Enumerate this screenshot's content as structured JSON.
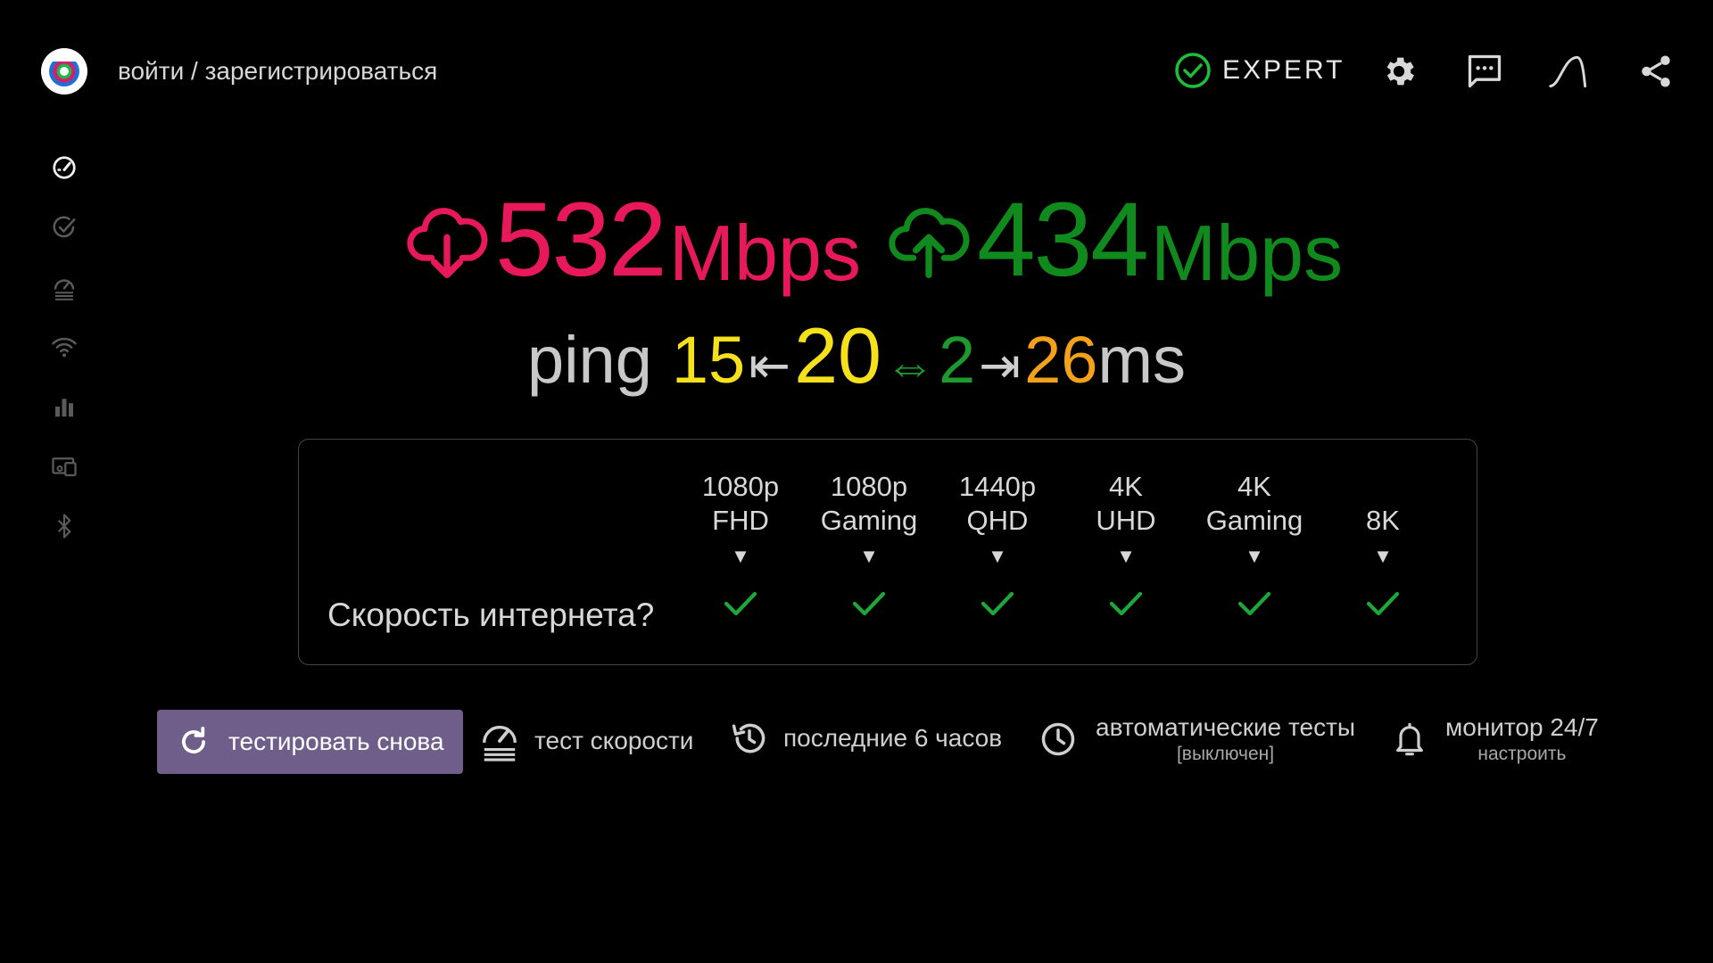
{
  "header": {
    "login_text": "войти / зарегистрироваться",
    "expert_label": "EXPERT"
  },
  "icons": {
    "logo": "app-logo",
    "top": [
      "check-circle-icon",
      "gear-icon",
      "chat-icon",
      "curve-icon",
      "share-icon"
    ],
    "sidebar": [
      "speedometer-icon",
      "check-circle-icon",
      "speedtest-history-icon",
      "wifi-icon",
      "bar-chart-icon",
      "devices-icon",
      "bluetooth-icon"
    ]
  },
  "speeds": {
    "download_value": "532",
    "download_unit": "Mbps",
    "upload_value": "434",
    "upload_unit": "Mbps"
  },
  "ping": {
    "label": "ping",
    "min": "15",
    "left_arrow": "⇤",
    "median": "20",
    "double_arrow": "⇔",
    "jitter": "2",
    "right_arrow": "⇥",
    "max": "26",
    "unit": "ms"
  },
  "quality": {
    "question": "Скорость интернета?",
    "columns": [
      {
        "line1": "1080p",
        "line2": "FHD",
        "ok": true
      },
      {
        "line1": "1080p",
        "line2": "Gaming",
        "ok": true
      },
      {
        "line1": "1440p",
        "line2": "QHD",
        "ok": true
      },
      {
        "line1": "4K",
        "line2": "UHD",
        "ok": true
      },
      {
        "line1": "4K",
        "line2": "Gaming",
        "ok": true
      },
      {
        "line1": "",
        "line2": "8K",
        "ok": true
      }
    ],
    "caret": "▼"
  },
  "bottom": {
    "retest_label": "тестировать снова",
    "speedtest_label": "тест скорости",
    "history_label": "последние 6 часов",
    "auto_tests_label": "автоматические тесты",
    "auto_tests_status": "[выключен]",
    "monitor_label": "монитор 24/7",
    "monitor_sub": "настроить"
  },
  "colors": {
    "download": "#e8195a",
    "upload": "#108a1c",
    "ping_min_median": "#f5e01c",
    "ping_jitter": "#1c9a2e",
    "ping_max": "#f3a01a",
    "retest_button": "#6f5e8a",
    "expert_check": "#1dbf3a"
  }
}
